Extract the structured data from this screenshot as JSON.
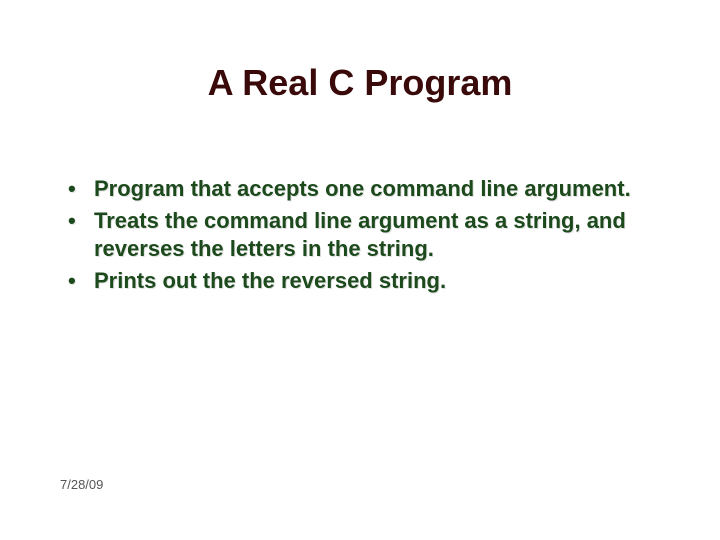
{
  "slide": {
    "title": "A Real C Program",
    "bullets": [
      "Program that accepts one command line argument.",
      "Treats the command line argument as a string, and reverses the letters in the string.",
      "Prints out the the reversed string."
    ],
    "footer_date": "7/28/09"
  }
}
